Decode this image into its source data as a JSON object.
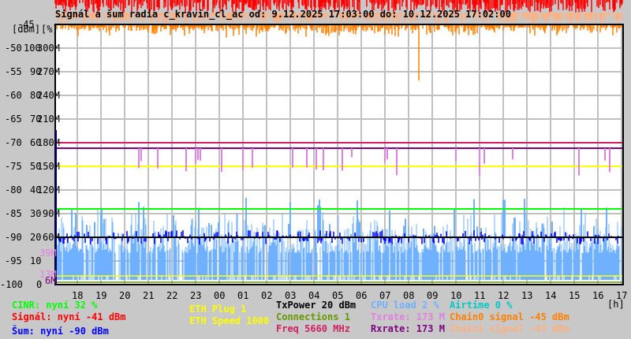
{
  "chart_data": {
    "type": "line",
    "title": "Signál a šum radia c_kravin_cl_ac od: 9.12.2025 17:03:00 do: 10.12.2025 17:02:00",
    "y_units": [
      "[dBm]",
      "[%]"
    ],
    "y_ticks_dbm": [
      "-45",
      "-50",
      "-55",
      "-60",
      "-65",
      "-70",
      "-75",
      "-80",
      "-85",
      "-90",
      "-95",
      "-100"
    ],
    "y_ticks_pct": [
      "100",
      "90",
      "80",
      "70",
      "60",
      "50",
      "40",
      "30",
      "20",
      "10",
      "0"
    ],
    "y_ticks_rate": [
      "300M",
      "270M",
      "240M",
      "210M",
      "180M",
      "150M",
      "120M",
      "90M",
      "60M"
    ],
    "extra_rate_labels": [
      {
        "text": "39M",
        "color": "#e080e0"
      },
      {
        "text": "13M",
        "color": "#e080e0"
      },
      {
        "text": "6M",
        "color": "#800080"
      }
    ],
    "x_ticks": [
      "18",
      "19",
      "20",
      "21",
      "22",
      "23",
      "00",
      "01",
      "02",
      "03",
      "04",
      "05",
      "06",
      "07",
      "08",
      "09",
      "10",
      "11",
      "12",
      "13",
      "14",
      "15",
      "16",
      "17"
    ],
    "x_unit": "[h]",
    "ylim_dbm": [
      -100,
      -45
    ],
    "grid": true,
    "series": [
      {
        "name": "Signál",
        "color": "#ff0000",
        "current": -41
      },
      {
        "name": "Chain0 signal",
        "color": "#ff8000",
        "current": -45
      },
      {
        "name": "Chain1 signal",
        "color": "#ffb080",
        "current": -43
      },
      {
        "name": "Šum",
        "color": "#0000ff",
        "current": -90
      },
      {
        "name": "CINR",
        "color": "#00ff00",
        "current": 32
      },
      {
        "name": "CPU load",
        "color": "#6fb0ff",
        "current": 2
      },
      {
        "name": "TxPower",
        "color": "#000000",
        "current": 20
      },
      {
        "name": "Freq",
        "color": "#d02060",
        "current": 5660
      },
      {
        "name": "Rxrate",
        "color": "#800080",
        "current": 173
      },
      {
        "name": "Txrate",
        "color": "#e080e0",
        "current": 173
      },
      {
        "name": "ETH Speed",
        "color": "#ffff00",
        "current": 1000
      },
      {
        "name": "ETH Plug",
        "color": "#ffff00",
        "current": 1
      },
      {
        "name": "Connections",
        "color": "#669900",
        "current": 1
      }
    ]
  },
  "legend": {
    "cinr": "CINR: nyní 32 %",
    "signal": "Signál: nyní -41 dBm",
    "noise": "Šum: nyní -90 dBm",
    "eth_plug": "ETH Plug 1",
    "eth_speed": "ETH Speed 1000",
    "txpower": "TxPower 20 dBm",
    "connections": "Connections 1",
    "freq": "Freq 5660 MHz",
    "cpu": "CPU load 2 %",
    "txrate": "Txrate: 173 M",
    "rxrate": "Rxrate: 173 M",
    "airtime": "Airtime 0 %",
    "chain0": "Chain0 signal -45 dBm",
    "chain1": "Chain1 signal -43 dBm"
  }
}
